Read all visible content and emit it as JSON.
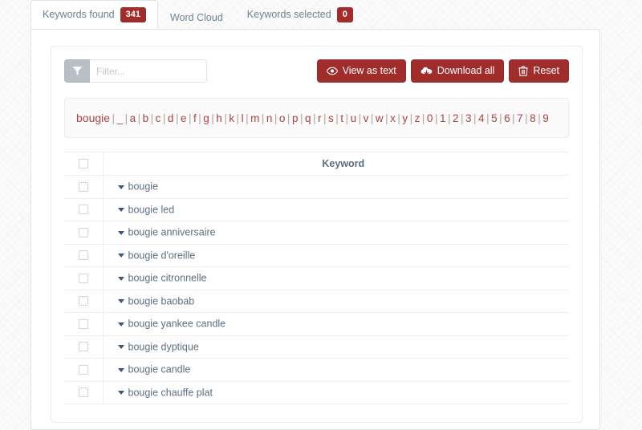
{
  "tabs": [
    {
      "label": "Keywords found",
      "badge": "341",
      "active": true,
      "name": "tab-keywords-found"
    },
    {
      "label": "Word Cloud",
      "badge": null,
      "active": false,
      "name": "tab-word-cloud"
    },
    {
      "label": "Keywords selected",
      "badge": "0",
      "active": false,
      "name": "tab-keywords-selected"
    }
  ],
  "toolbar": {
    "filter_placeholder": "Filter...",
    "filter_value": "",
    "filter_icon": "funnel-icon",
    "buttons": [
      {
        "label": "View as text",
        "icon": "eye-icon",
        "name": "view-as-text-button"
      },
      {
        "label": "Download all",
        "icon": "cloud-download-icon",
        "name": "download-all-button"
      },
      {
        "label": "Reset",
        "icon": "trash-icon",
        "name": "reset-button"
      }
    ]
  },
  "alphabet": {
    "root": "bougie",
    "items": [
      "_",
      "a",
      "b",
      "c",
      "d",
      "e",
      "f",
      "g",
      "h",
      "k",
      "l",
      "m",
      "n",
      "o",
      "p",
      "q",
      "r",
      "s",
      "t",
      "u",
      "v",
      "w",
      "x",
      "y",
      "z",
      "0",
      "1",
      "2",
      "3",
      "4",
      "5",
      "6",
      "7",
      "8",
      "9"
    ],
    "separator": "|"
  },
  "table": {
    "columns": [
      "",
      "Keyword"
    ],
    "header_keyword": "Keyword",
    "rows": [
      {
        "keyword": "bougie",
        "checked": false
      },
      {
        "keyword": "bougie led",
        "checked": false
      },
      {
        "keyword": "bougie anniversaire",
        "checked": false
      },
      {
        "keyword": "bougie d'oreille",
        "checked": false
      },
      {
        "keyword": "bougie citronnelle",
        "checked": false
      },
      {
        "keyword": "bougie baobab",
        "checked": false
      },
      {
        "keyword": "bougie yankee candle",
        "checked": false
      },
      {
        "keyword": "bougie dyptique",
        "checked": false
      },
      {
        "keyword": "bougie candle",
        "checked": false
      },
      {
        "keyword": "bougie chauffe plat",
        "checked": false
      }
    ]
  },
  "colors": {
    "brand_red": "#a02c2c",
    "link_red": "#a94442",
    "text_slate": "#5b6e82",
    "muted": "#6f8296"
  }
}
